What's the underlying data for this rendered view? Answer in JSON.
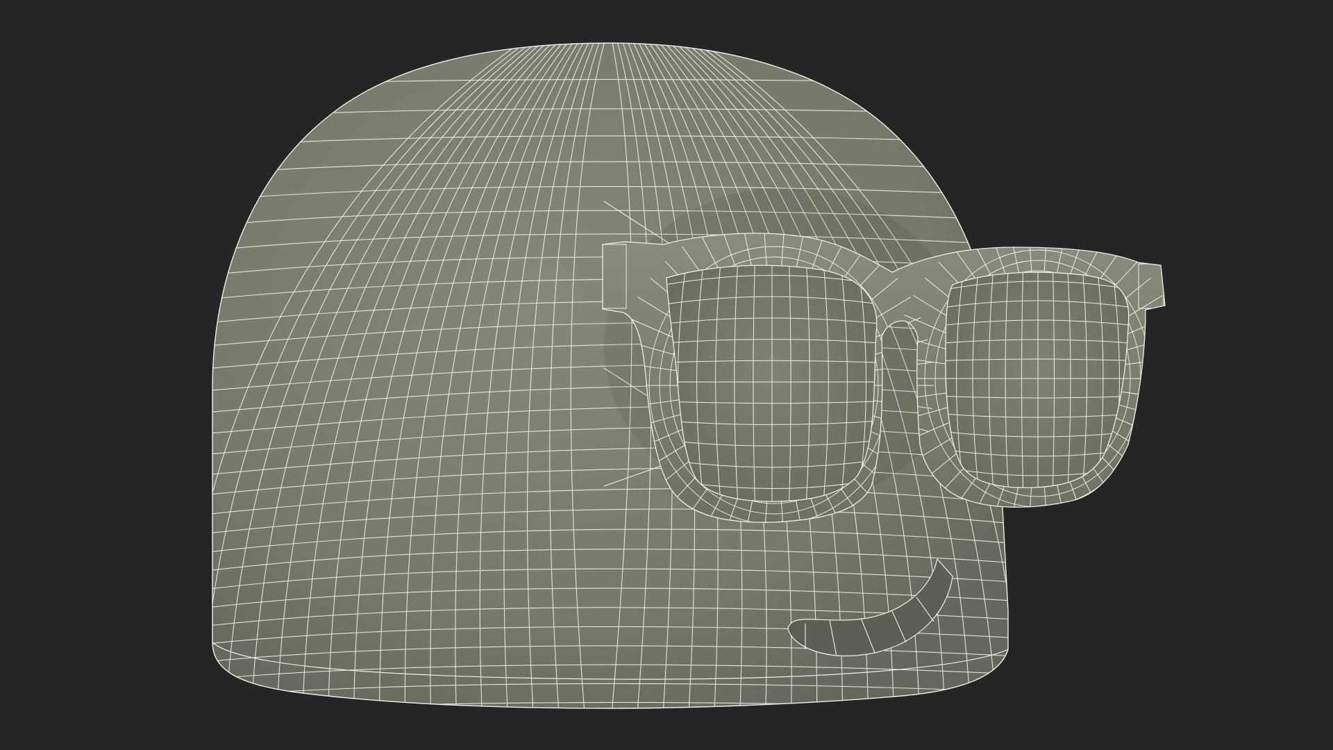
{
  "colors": {
    "background": "#252525",
    "surface": "#7b7b6e",
    "surface_shade": "#6b6b60",
    "surface_dark": "#5e5e55",
    "wire": "#f2efe6"
  },
  "labels": [],
  "controls": []
}
